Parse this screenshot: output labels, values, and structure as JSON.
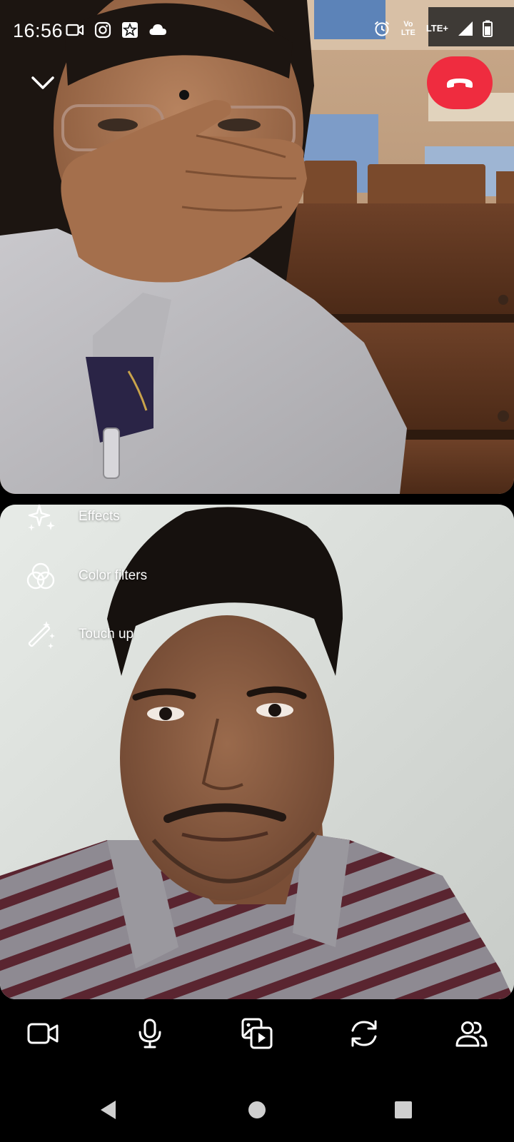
{
  "status_bar": {
    "time": "16:56",
    "left_icons": [
      "video-recorder-icon",
      "instagram-icon",
      "star-app-icon",
      "cloud-icon"
    ],
    "right_icons": [
      "alarm-icon",
      "volte-icon",
      "lte-plus-icon",
      "signal-icon",
      "battery-icon"
    ],
    "volte_label": "Vo LTE",
    "lte_label": "LTE+"
  },
  "header": {
    "minimize_icon": "chevron-down-icon",
    "end_call_icon": "phone-hangup-icon",
    "end_call_color": "#ef2c3f"
  },
  "effects_menu": {
    "items": [
      {
        "label": "Effects",
        "icon": "sparkles-icon"
      },
      {
        "label": "Color filters",
        "icon": "color-filters-icon"
      },
      {
        "label": "Touch up",
        "icon": "magic-wand-icon"
      }
    ]
  },
  "call_controls": {
    "items": [
      {
        "icon": "video-camera-icon"
      },
      {
        "icon": "microphone-icon"
      },
      {
        "icon": "media-share-icon"
      },
      {
        "icon": "flip-camera-icon"
      },
      {
        "icon": "participants-icon"
      }
    ]
  },
  "nav_bar": {
    "items": [
      {
        "icon": "back-triangle-icon"
      },
      {
        "icon": "home-circle-icon"
      },
      {
        "icon": "recents-square-icon"
      }
    ]
  }
}
